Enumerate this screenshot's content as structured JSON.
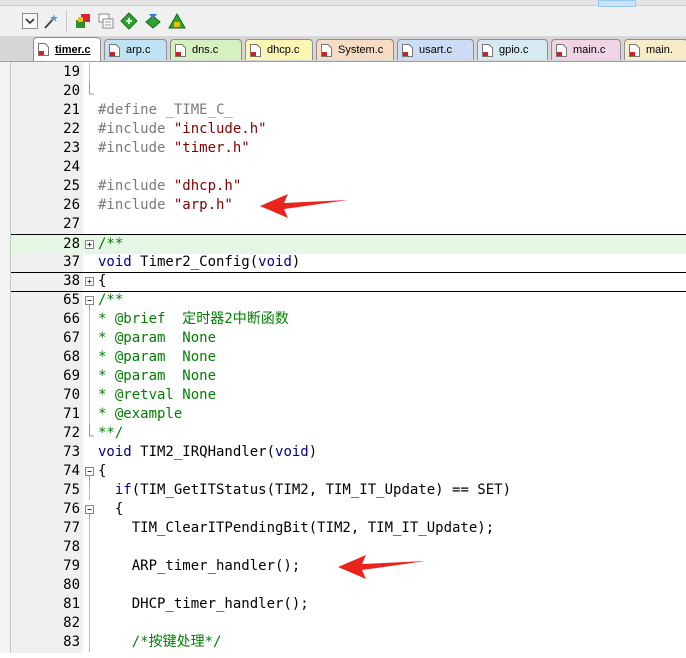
{
  "tabs": [
    {
      "label": "timer.c",
      "active": true,
      "color": "#ffffff"
    },
    {
      "label": "arp.c",
      "active": false,
      "color": "#bfe3f5"
    },
    {
      "label": "dns.c",
      "active": false,
      "color": "#d7f0c0"
    },
    {
      "label": "dhcp.c",
      "active": false,
      "color": "#fbf6b4"
    },
    {
      "label": "System.c",
      "active": false,
      "color": "#f6dcc2"
    },
    {
      "label": "usart.c",
      "active": false,
      "color": "#ccdcf4"
    },
    {
      "label": "gpio.c",
      "active": false,
      "color": "#d7eaf2"
    },
    {
      "label": "main.c",
      "active": false,
      "color": "#f0d3e4"
    },
    {
      "label": "main.",
      "active": false,
      "color": "#f6ecc8"
    }
  ],
  "lines": [
    {
      "n": "19",
      "segs": []
    },
    {
      "n": "20",
      "segs": []
    },
    {
      "n": "21",
      "segs": [
        {
          "t": "#define _TIME_C_",
          "c": "pre"
        }
      ]
    },
    {
      "n": "22",
      "segs": [
        {
          "t": "#include ",
          "c": "pre"
        },
        {
          "t": "\"include.h\"",
          "c": "str"
        }
      ]
    },
    {
      "n": "23",
      "segs": [
        {
          "t": "#include ",
          "c": "pre"
        },
        {
          "t": "\"timer.h\"",
          "c": "str"
        }
      ]
    },
    {
      "n": "24",
      "segs": []
    },
    {
      "n": "25",
      "segs": [
        {
          "t": "#include ",
          "c": "pre"
        },
        {
          "t": "\"dhcp.h\"",
          "c": "str"
        }
      ]
    },
    {
      "n": "26",
      "segs": [
        {
          "t": "#include ",
          "c": "pre"
        },
        {
          "t": "\"arp.h\"",
          "c": "str"
        }
      ]
    },
    {
      "n": "27",
      "segs": []
    },
    {
      "n": "28",
      "segs": [
        {
          "t": "/**",
          "c": "cm"
        }
      ]
    },
    {
      "n": "37",
      "segs": [
        {
          "t": "void",
          "c": "kw"
        },
        {
          "t": " Timer2_Config(",
          "c": "fn"
        },
        {
          "t": "void",
          "c": "kw"
        },
        {
          "t": ")",
          "c": "fn"
        }
      ]
    },
    {
      "n": "38",
      "segs": [
        {
          "t": "{",
          "c": "fn"
        }
      ]
    },
    {
      "n": "65",
      "segs": [
        {
          "t": "/**",
          "c": "cm"
        }
      ]
    },
    {
      "n": "66",
      "segs": [
        {
          "t": "* @brief  定时器2中断函数",
          "c": "cm"
        }
      ]
    },
    {
      "n": "67",
      "segs": [
        {
          "t": "* @param  None",
          "c": "cm"
        }
      ]
    },
    {
      "n": "68",
      "segs": [
        {
          "t": "* @param  None",
          "c": "cm"
        }
      ]
    },
    {
      "n": "69",
      "segs": [
        {
          "t": "* @param  None",
          "c": "cm"
        }
      ]
    },
    {
      "n": "70",
      "segs": [
        {
          "t": "* @retval None",
          "c": "cm"
        }
      ]
    },
    {
      "n": "71",
      "segs": [
        {
          "t": "* @example",
          "c": "cm"
        }
      ]
    },
    {
      "n": "72",
      "segs": [
        {
          "t": "**/",
          "c": "cm"
        }
      ]
    },
    {
      "n": "73",
      "segs": [
        {
          "t": "void",
          "c": "kw"
        },
        {
          "t": " TIM2_IRQHandler(",
          "c": "fn"
        },
        {
          "t": "void",
          "c": "kw"
        },
        {
          "t": ")",
          "c": "fn"
        }
      ]
    },
    {
      "n": "74",
      "segs": [
        {
          "t": "{",
          "c": "fn"
        }
      ]
    },
    {
      "n": "75",
      "segs": [
        {
          "t": "  ",
          "c": "fn"
        },
        {
          "t": "if",
          "c": "kw"
        },
        {
          "t": "(TIM_GetITStatus(TIM2, TIM_IT_Update) == SET)",
          "c": "fn"
        }
      ]
    },
    {
      "n": "76",
      "segs": [
        {
          "t": "  {",
          "c": "fn"
        }
      ]
    },
    {
      "n": "77",
      "segs": [
        {
          "t": "    TIM_ClearITPendingBit(TIM2, TIM_IT_Update);",
          "c": "fn"
        }
      ]
    },
    {
      "n": "78",
      "segs": []
    },
    {
      "n": "79",
      "segs": [
        {
          "t": "    ARP_timer_handler();",
          "c": "fn"
        }
      ]
    },
    {
      "n": "80",
      "segs": []
    },
    {
      "n": "81",
      "segs": [
        {
          "t": "    DHCP_timer_handler();",
          "c": "fn"
        }
      ]
    },
    {
      "n": "82",
      "segs": []
    },
    {
      "n": "83",
      "segs": [
        {
          "t": "    /*按键处理*/",
          "c": "cm"
        }
      ]
    }
  ],
  "colors": {
    "preprocessor": "#7a7a7a",
    "string": "#800000",
    "keyword": "#00008b",
    "comment": "#008000",
    "fold_highlight": "#e6f7e6",
    "arrow": "#e8241c"
  }
}
